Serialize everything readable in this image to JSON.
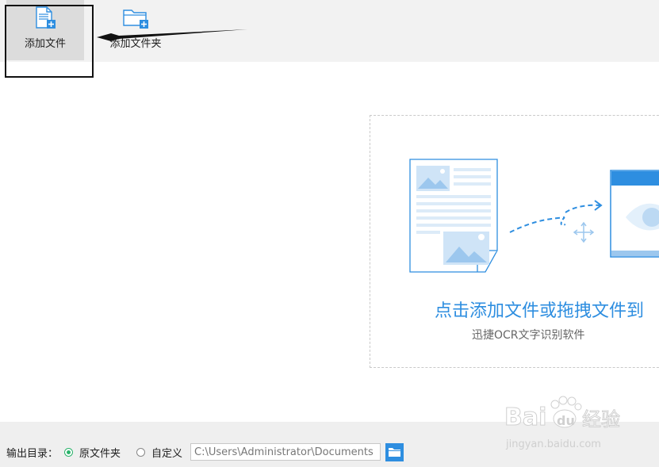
{
  "toolbar": {
    "add_file_label": "添加文件",
    "add_folder_label": "添加文件夹"
  },
  "dropzone": {
    "title": "点击添加文件或拖拽文件到",
    "subtitle": "迅捷OCR文字识别软件"
  },
  "output": {
    "label": "输出目录：",
    "option_source": "原文件夹",
    "option_custom": "自定义",
    "selected": "原文件夹",
    "path_value": "C:\\Users\\Administrator\\Documents"
  },
  "watermark": {
    "brand": "Bai",
    "brand2": "du",
    "cn": "经验",
    "url": "jingyan.baidu.com"
  },
  "colors": {
    "accent": "#2e8ee0",
    "radio_checked": "#2bb36b",
    "toolbar_bg": "#f2f2f2"
  },
  "icons": {
    "add_file": "file-plus-icon",
    "add_folder": "folder-plus-icon",
    "browse": "folder-icon",
    "move": "move-icon",
    "eye": "eye-icon"
  }
}
